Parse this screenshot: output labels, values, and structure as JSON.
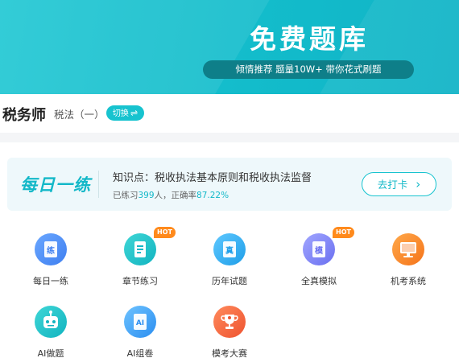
{
  "banner": {
    "title": "免费题库",
    "tagline": "倾情推荐 题量10W+ 带你花式刷题"
  },
  "subject": {
    "name": "税务师",
    "course": "税法（一）",
    "switch_label": "切换",
    "switch_icon": "⇌"
  },
  "daily": {
    "logo": "每日一练",
    "topic": "知识点：税收执法基本原则和税收执法监督",
    "stats_prefix": "已练习",
    "practiced": "399",
    "stats_middle": "人，正确率",
    "accuracy": "87.22%",
    "checkin_label": "去打卡",
    "checkin_icon": "›"
  },
  "features": [
    {
      "label": "每日一练",
      "icon": "practice-icon",
      "glyph": "练",
      "hot": false,
      "color": "#4f8ff3"
    },
    {
      "label": "章节练习",
      "icon": "chapter-icon",
      "glyph": "",
      "hot": true,
      "hot_label": "HOT",
      "color": "#1fc3c9"
    },
    {
      "label": "历年试题",
      "icon": "past-exam-icon",
      "glyph": "真",
      "hot": false,
      "color": "#35b2f0"
    },
    {
      "label": "全真模拟",
      "icon": "mock-exam-icon",
      "glyph": "模",
      "hot": true,
      "hot_label": "HOT",
      "color": "#7d83f3"
    },
    {
      "label": "机考系统",
      "icon": "computer-exam-icon",
      "glyph": "",
      "hot": false,
      "color": "#fb8a2c"
    },
    {
      "label": "AI做题",
      "icon": "ai-robot-icon",
      "glyph": "",
      "hot": false,
      "color": "#1fc3c9"
    },
    {
      "label": "AI组卷",
      "icon": "ai-paper-icon",
      "glyph": "AI",
      "hot": false,
      "color": "#45a3f3"
    },
    {
      "label": "模考大赛",
      "icon": "trophy-icon",
      "glyph": "",
      "hot": false,
      "color": "#f46c4a"
    }
  ]
}
